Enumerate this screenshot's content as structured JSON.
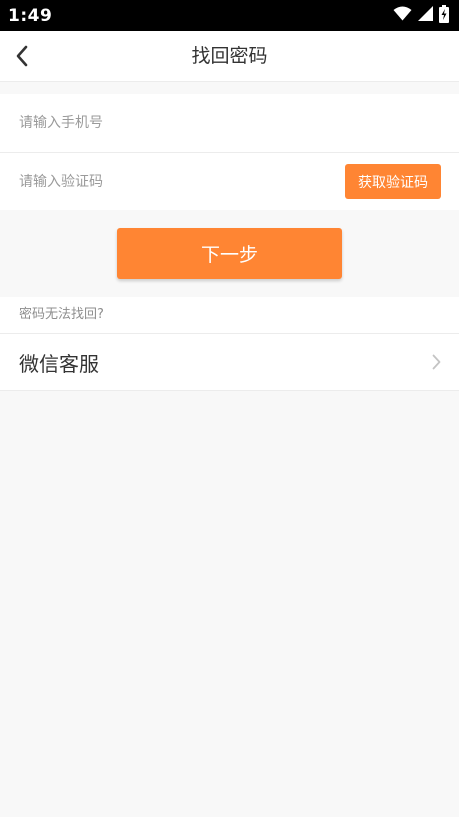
{
  "status_bar": {
    "time": "1:49",
    "icons": [
      "wifi-icon",
      "signal-icon",
      "battery-charging-icon"
    ]
  },
  "header": {
    "title": "找回密码",
    "back_icon": "chevron-left-icon"
  },
  "form": {
    "phone": {
      "placeholder": "请输入手机号",
      "value": ""
    },
    "code": {
      "placeholder": "请输入验证码",
      "value": ""
    },
    "get_code_label": "获取验证码"
  },
  "next_label": "下一步",
  "help": {
    "hint": "密码无法找回?",
    "service_label": "微信客服",
    "service_icon": "chevron-right-icon"
  },
  "colors": {
    "accent": "#ff8533",
    "background": "#f8f8f8",
    "status_bar": "#000000"
  }
}
